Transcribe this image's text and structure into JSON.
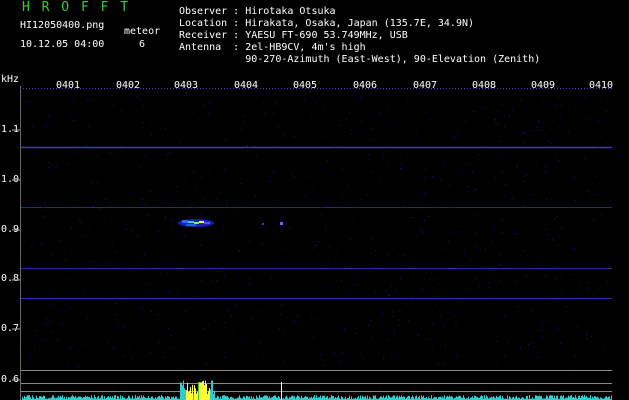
{
  "header": {
    "app_title": "H R O F F T",
    "filename": "HI12050400.png",
    "datetime": "10.12.05 04:00",
    "meteor_label": "meteor",
    "meteor_count": "6"
  },
  "info": {
    "observer": "Observer : Hirotaka Otsuka",
    "location": "Location : Hirakata, Osaka, Japan (135.7E, 34.9N)",
    "receiver": "Receiver : YAESU FT-690 53.749MHz, USB",
    "antenna": "Antenna  : 2el-HB9CV, 4m's high",
    "antenna_detail": "           90-270-Azimuth (East-West), 90-Elevation (Zenith)"
  },
  "axis": {
    "unit": "kHz",
    "y_labels": [
      "1.1",
      "1.0",
      "0.9",
      "0.8",
      "0.7",
      "0.6"
    ],
    "x_labels": [
      "0401",
      "0402",
      "0403",
      "0404",
      "0405",
      "0406",
      "0407",
      "0408",
      "0409",
      "0410"
    ]
  },
  "colors": {
    "background": "#000000",
    "title_green": "#33cc33",
    "noise_blue": "#1a1aa0",
    "signal_yellow": "#ffff33",
    "spectrum_cyan": "#33cccc"
  }
}
